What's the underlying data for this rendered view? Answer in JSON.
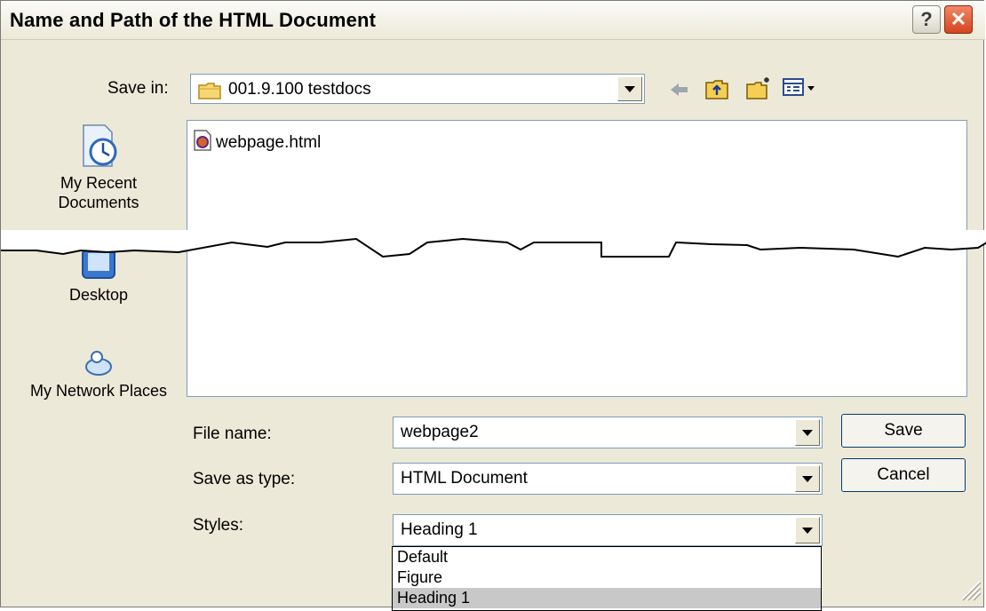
{
  "window": {
    "title": "Name and Path of the HTML Document",
    "help_label": "?",
    "close_label": "✕"
  },
  "toolbar": {
    "save_in_label": "Save in:",
    "save_in_value": "001.9.100 testdocs",
    "icons": [
      "back-icon",
      "up-folder-icon",
      "new-folder-icon",
      "views-menu-icon"
    ]
  },
  "places": [
    {
      "name": "recent",
      "label": "My Recent Documents"
    },
    {
      "name": "desktop",
      "label": "Desktop"
    },
    {
      "name": "network",
      "label": "My Network Places"
    }
  ],
  "files": [
    {
      "name": "webpage.html"
    }
  ],
  "form": {
    "file_name_label": "File name:",
    "file_name_value": "webpage2",
    "save_type_label": "Save as type:",
    "save_type_value": "HTML Document",
    "styles_label": "Styles:",
    "styles_value": "Heading 1"
  },
  "buttons": {
    "save": "Save",
    "cancel": "Cancel"
  },
  "styles_options": [
    {
      "label": "Default",
      "selected": false
    },
    {
      "label": "Figure",
      "selected": false
    },
    {
      "label": "Heading 1",
      "selected": true
    }
  ]
}
